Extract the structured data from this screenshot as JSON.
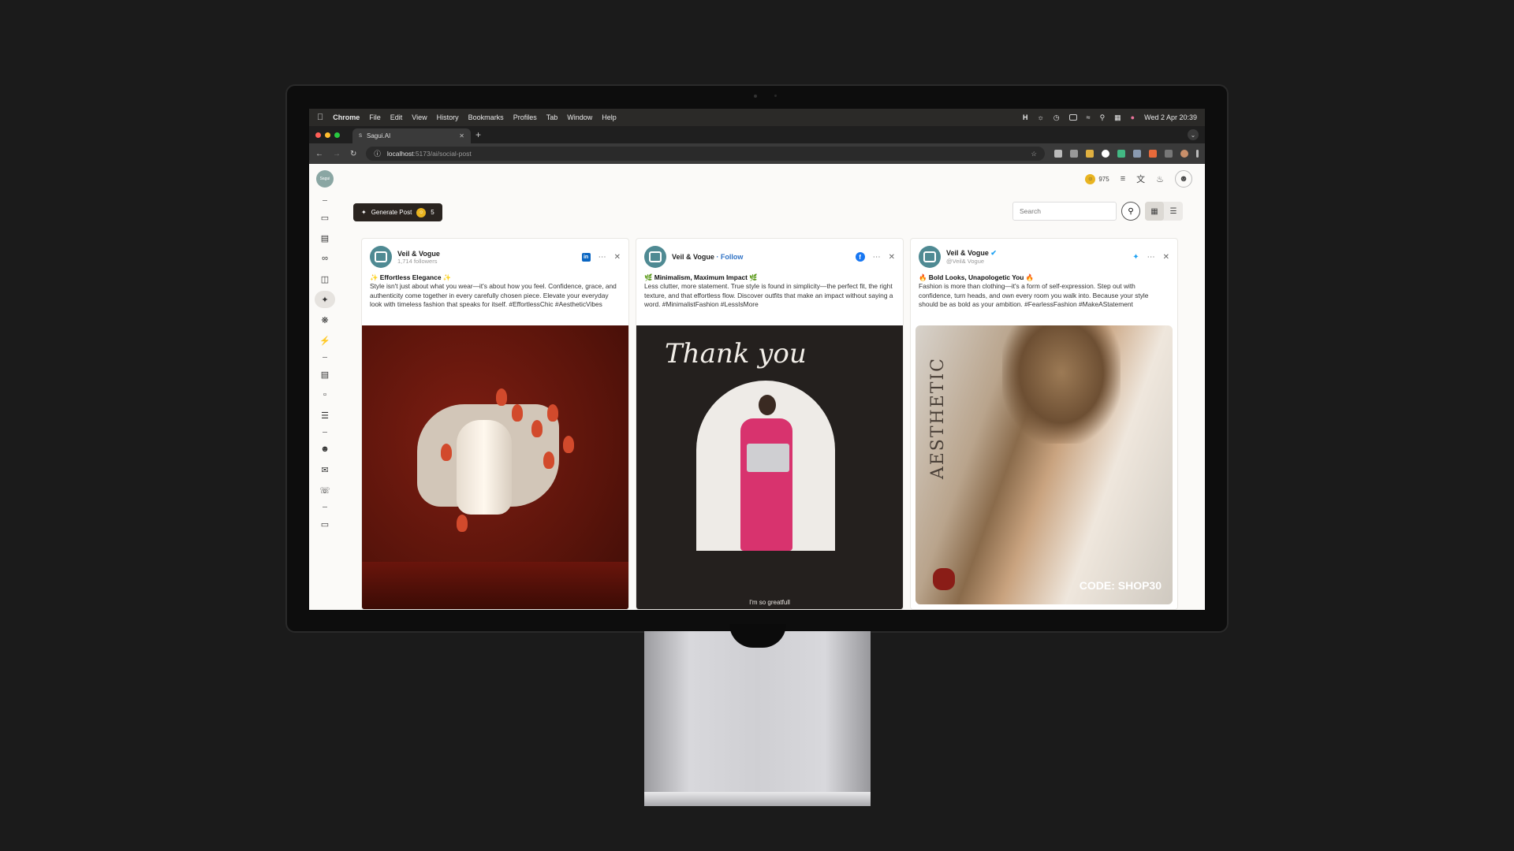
{
  "menubar": {
    "app": "Chrome",
    "items": [
      "File",
      "Edit",
      "View",
      "History",
      "Bookmarks",
      "Profiles",
      "Tab",
      "Window",
      "Help"
    ],
    "datetime": "Wed 2 Apr  20:39"
  },
  "browser": {
    "tab_title": "Sagui.AI",
    "url_host": "localhost",
    "url_path": ":5173/ai/social-post"
  },
  "sidebar": {
    "logo_text": "Sagui"
  },
  "topbar": {
    "credits": "975"
  },
  "controls": {
    "generate_label": "Generate Post",
    "generate_cost": "5",
    "search_placeholder": "Search"
  },
  "posts": [
    {
      "platform": "linkedin",
      "brand": "Veil & Vogue",
      "sub": "1,714 followers",
      "title": "✨ Effortless Elegance ✨",
      "text": "Style isn't just about what you wear—it's about how you feel. Confidence, grace, and authenticity come together in every carefully chosen piece. Elevate your everyday look with timeless fashion that speaks for itself. #EffortlessChic #AestheticVibes"
    },
    {
      "platform": "facebook",
      "brand": "Veil & Vogue",
      "follow": "· Follow",
      "title": "🌿 Minimalism, Maximum Impact 🌿",
      "text": "Less clutter, more statement. True style is found in simplicity—the perfect fit, the right texture, and that effortless flow. Discover outfits that make an impact without saying a word. #MinimalistFashion #LessIsMore",
      "image_script": "Thank you",
      "image_caption": "I'm so greatfull"
    },
    {
      "platform": "twitter",
      "brand": "Veil & Vogue",
      "sub": "@Veil& Vogue",
      "title": "🔥 Bold Looks, Unapologetic You 🔥",
      "text": "Fashion is more than clothing—it's a form of self-expression. Step out with confidence, turn heads, and own every room you walk into. Because your style should be as bold as your ambition. #FearlessFashion #MakeAStatement",
      "image_vertical": "AESTHETIC",
      "image_code": "CODE: SHOP30"
    }
  ]
}
